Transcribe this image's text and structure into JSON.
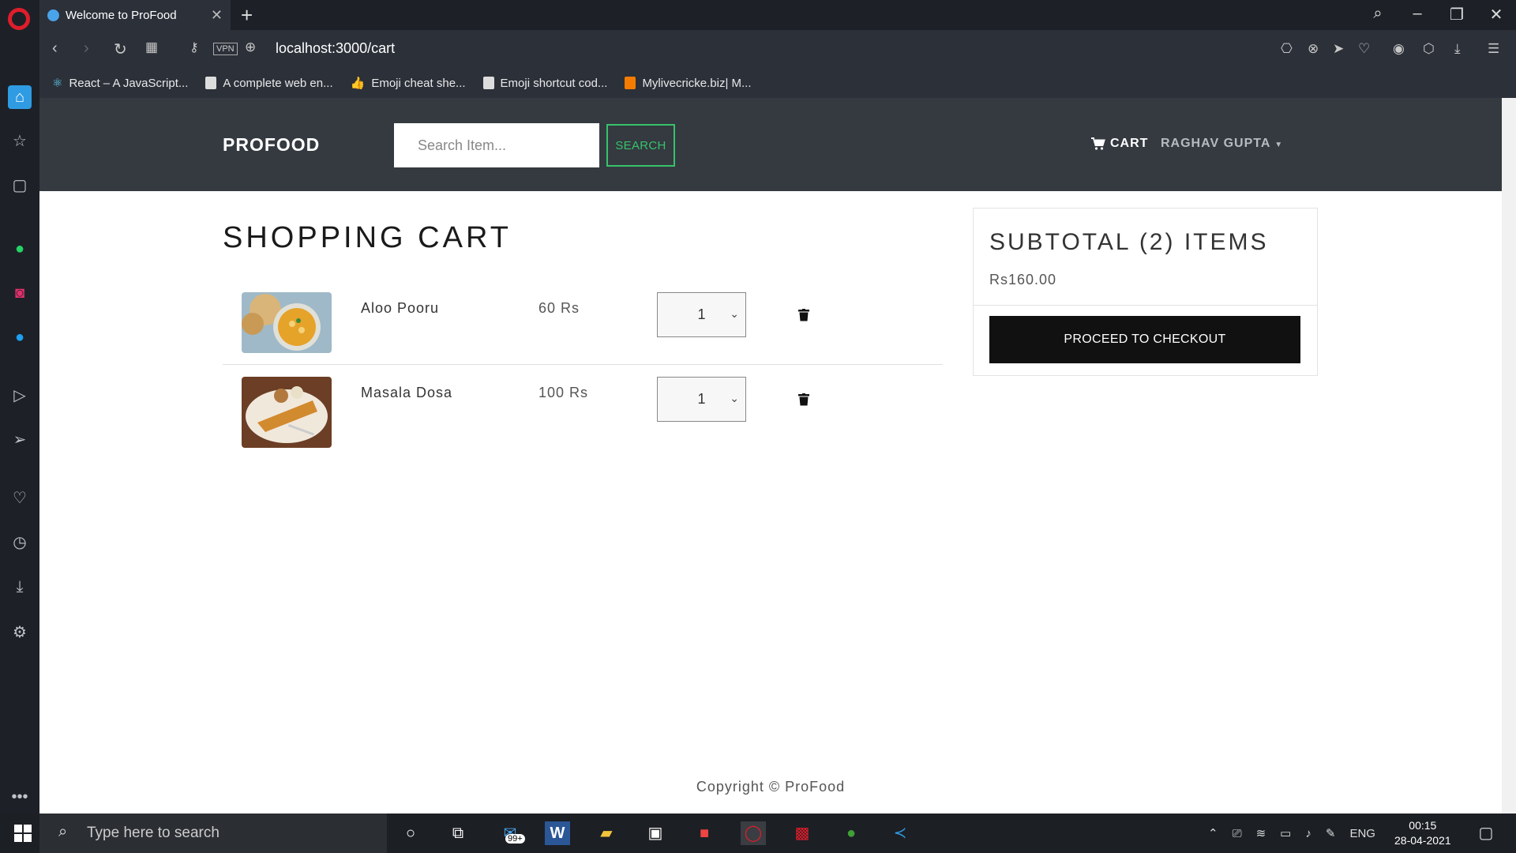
{
  "browser": {
    "tab_title": "Welcome to ProFood",
    "url_host": "localhost",
    "url_path": ":3000/cart",
    "vpn_label": "VPN",
    "bookmarks": [
      "React – A JavaScript...",
      "A complete web en...",
      "Emoji cheat she...",
      "Emoji shortcut cod...",
      "Mylivecricke.biz| M..."
    ]
  },
  "navbar": {
    "brand": "PROFOOD",
    "search_placeholder": "Search Item...",
    "search_button": "SEARCH",
    "cart_label": "CART",
    "user_name": "RAGHAV GUPTA"
  },
  "cart": {
    "title": "SHOPPING CART",
    "items": [
      {
        "name": "Aloo Pooru",
        "price": "60 Rs",
        "qty": "1"
      },
      {
        "name": "Masala Dosa",
        "price": "100 Rs",
        "qty": "1"
      }
    ]
  },
  "summary": {
    "title": "SUBTOTAL (2) ITEMS",
    "total": "Rs160.00",
    "checkout_button": "PROCEED TO CHECKOUT"
  },
  "footer": {
    "text": "Copyright © ProFood"
  },
  "taskbar": {
    "search_placeholder": "Type here to search",
    "mail_badge": "99+",
    "language": "ENG",
    "time": "00:15",
    "date": "28-04-2021"
  },
  "colors": {
    "navbar": "#343a40",
    "accent_green": "#37c26a",
    "checkout": "#111111"
  }
}
